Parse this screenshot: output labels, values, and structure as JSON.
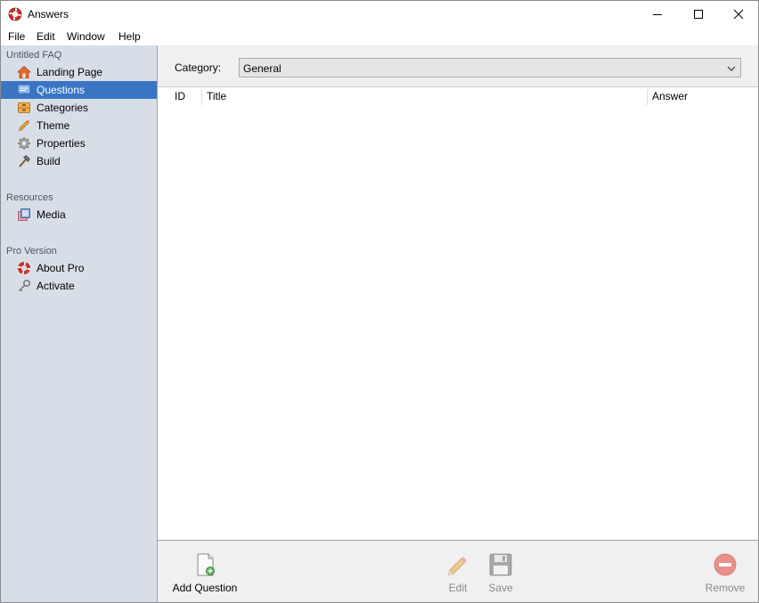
{
  "window": {
    "title": "Answers",
    "icon": "lifebuoy-icon"
  },
  "menu": [
    "File",
    "Edit",
    "Window",
    "Help"
  ],
  "sidebar": {
    "project_label": "Untitled FAQ",
    "project_items": [
      {
        "label": "Landing Page",
        "icon": "house-icon"
      },
      {
        "label": "Questions",
        "icon": "speech-bubble-icon",
        "selected": true
      },
      {
        "label": "Categories",
        "icon": "drawer-icon"
      },
      {
        "label": "Theme",
        "icon": "pencil-icon"
      },
      {
        "label": "Properties",
        "icon": "gear-icon"
      },
      {
        "label": "Build",
        "icon": "hammer-icon"
      }
    ],
    "resources_label": "Resources",
    "resources_items": [
      {
        "label": "Media",
        "icon": "media-icon"
      }
    ],
    "pro_label": "Pro Version",
    "pro_items": [
      {
        "label": "About Pro",
        "icon": "lifebuoy-icon"
      },
      {
        "label": "Activate",
        "icon": "key-icon"
      }
    ]
  },
  "category": {
    "label": "Category:",
    "selected": "General"
  },
  "table": {
    "columns": [
      "ID",
      "Title",
      "Answer"
    ],
    "rows": []
  },
  "toolbar": {
    "add_label": "Add Question",
    "edit_label": "Edit",
    "save_label": "Save",
    "remove_label": "Remove"
  },
  "colors": {
    "selection": "#3a75c4",
    "sidebar_bg": "#d8dee7",
    "remove_red": "#e0605a"
  }
}
